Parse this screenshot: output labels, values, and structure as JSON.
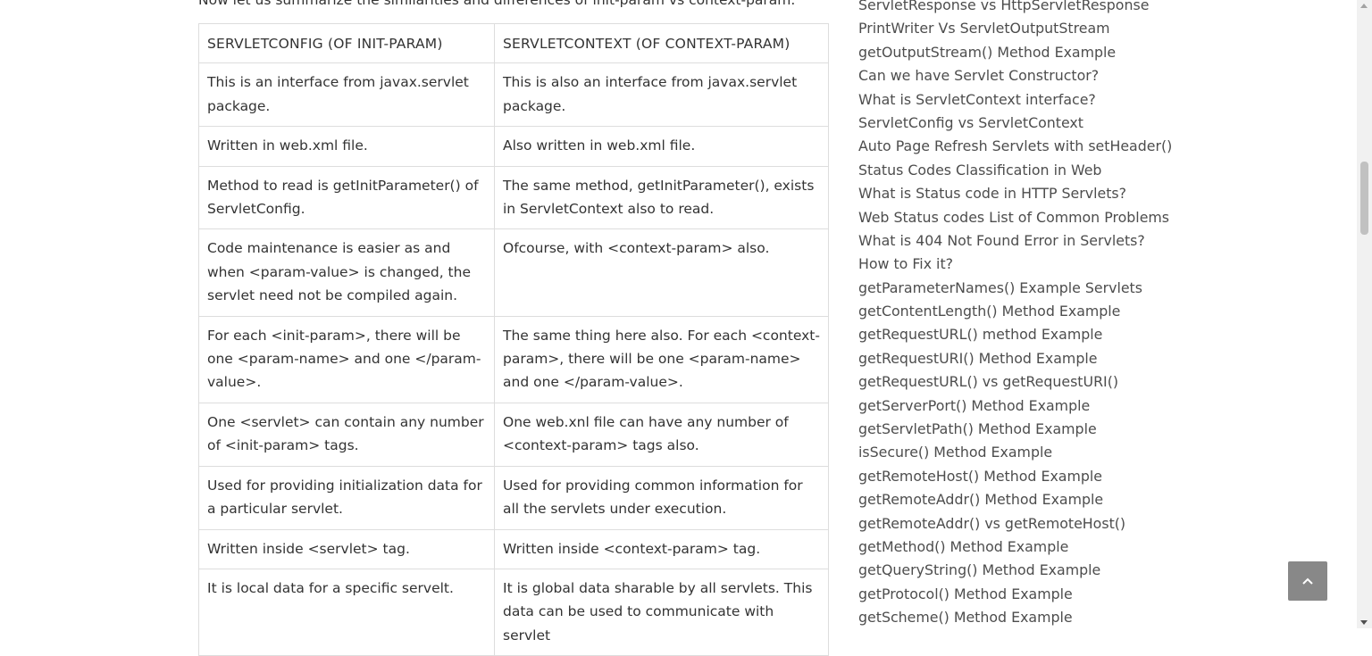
{
  "intro_text": "Now let us summarize the similarities and differences of init-param vs context-param.",
  "table": {
    "headers": [
      "SERVLETCONFIG (OF INIT-PARAM)",
      "SERVLETCONTEXT (OF CONTEXT-PARAM)"
    ],
    "rows": [
      [
        "This is an interface from javax.servlet package.",
        "This is also an interface from javax.servlet package."
      ],
      [
        "Written in web.xml file.",
        "Also written in web.xml file."
      ],
      [
        "Method to read is getInitParameter() of ServletConfig.",
        "The same method, getInitParameter(), exists in ServletContext also to read."
      ],
      [
        "Code maintenance is easier as and when <param-value> is changed, the servlet need not be compiled again.",
        "Ofcourse, with <context-param> also."
      ],
      [
        "For each <init-param>, there will be one <param-name> and one </param-value>.",
        "The same thing here also. For each <context-param>, there will be one <param-name> and one </param-value>."
      ],
      [
        "One <servlet> can contain any number of <init-param> tags.",
        "One web.xnl file can have any number of <context-param> tags also."
      ],
      [
        "Used for providing initialization data for a particular servlet.",
        "Used for providing common information for all the servlets under execution."
      ],
      [
        "Written inside <servlet> tag.",
        "Written inside <context-param> tag."
      ],
      [
        "It is local data for a specific servelt.",
        "It is global data sharable by all servlets. This data can be used to communicate with servlet"
      ]
    ]
  },
  "sidebar": {
    "links": [
      "ServletResponse vs HttpServletResponse",
      "PrintWriter Vs ServletOutputStream",
      "getOutputStream() Method Example",
      "Can we have Servlet Constructor?",
      "What is ServletContext interface?",
      "ServletConfig vs ServletContext",
      "Auto Page Refresh Servlets with setHeader()",
      "Status Codes Classification in Web",
      "What is Status code in HTTP Servlets?",
      "Web Status codes List of Common Problems",
      "What is 404 Not Found Error in Servlets?",
      "How to Fix it?",
      "getParameterNames() Example Servlets",
      "getContentLength() Method Example",
      "getRequestURL() method Example",
      "getRequestURI() Method Example",
      "getRequestURL() vs getRequestURI()",
      "getServerPort() Method Example",
      "getServletPath() Method Example",
      "isSecure() Method Example",
      "getRemoteHost() Method Example",
      "getRemoteAddr() Method Example",
      "getRemoteAddr() vs getRemoteHost()",
      "getMethod() Method Example",
      "getQueryString() Method Example",
      "getProtocol() Method Example",
      "getScheme() Method Example"
    ]
  },
  "scroll_top_button": {
    "icon": "chevron-up-icon",
    "color": "#888888"
  },
  "colors": {
    "link": "#4d4d4d",
    "text": "#333333",
    "border": "#dddddd"
  }
}
